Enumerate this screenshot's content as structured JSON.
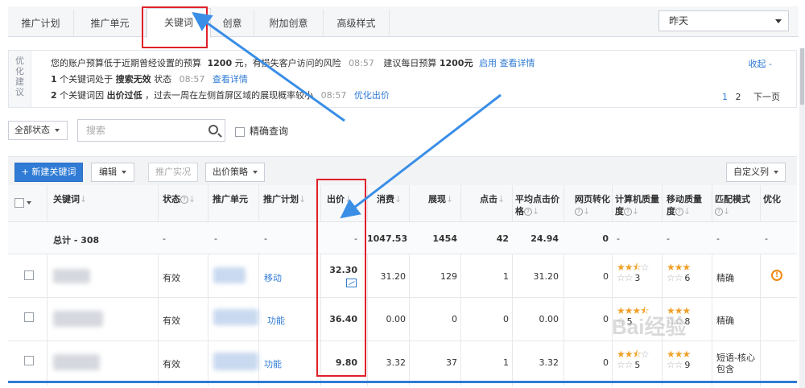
{
  "tabs": [
    {
      "label": "推广计划",
      "active": false
    },
    {
      "label": "推广单元",
      "active": false
    },
    {
      "label": "关键词",
      "active": true
    },
    {
      "label": "创意",
      "active": false
    },
    {
      "label": "附加创意",
      "active": false
    },
    {
      "label": "高级样式",
      "active": false
    }
  ],
  "date_select": {
    "value": "昨天"
  },
  "suggestions": {
    "side_label": "优化建议",
    "line1": {
      "pre": "您的账户预算低于近期曾经设置的预算",
      "budget": "1200",
      "mid": "元，有损失客户访问的风险",
      "time": "08:57",
      "suggest": "建议每日预算",
      "suggest_value": "1200元",
      "link1": "启用",
      "link2": "查看详情"
    },
    "line2": {
      "count": "1",
      "pre": "个关键词处于",
      "status": "搜索无效",
      "post": "状态",
      "time": "08:57",
      "link": "查看详情"
    },
    "line3": {
      "count": "2",
      "pre": "个关键词因",
      "reason": "出价过低",
      "post": "，过去一周在左侧首屏区域的展现概率较小",
      "time": "08:57",
      "link": "优化出价"
    },
    "collapse": "收起 -",
    "pager": {
      "p1": "1",
      "p2": "2",
      "next": "下一页"
    }
  },
  "filter": {
    "state": "全部状态",
    "search_placeholder": "搜索",
    "exact": "精确查询"
  },
  "toolbar": {
    "new_keyword": "+ 新建关键词",
    "edit": "编辑",
    "promo_test": "推广实况",
    "bid_strategy": "出价策略",
    "custom_cols": "自定义列"
  },
  "columns": {
    "keyword": "关键词",
    "status": "状态",
    "unit": "推广单元",
    "plan": "推广计划",
    "bid": "出价",
    "cost": "消费",
    "impressions": "展现",
    "clicks": "点击",
    "avg_cpc_1": "平均点击价",
    "avg_cpc_2": "格",
    "conv_1": "网页转化",
    "pc_quality_1": "计算机质量",
    "pc_quality_2": "度",
    "mobile_quality_1": "移动质量",
    "mobile_quality_2": "度",
    "match": "匹配模式",
    "optimize": "优化"
  },
  "total": {
    "label": "总计 - 308",
    "status": "-",
    "unit": "-",
    "plan": "-",
    "bid": "-",
    "cost": "1047.53",
    "impressions": "1454",
    "clicks": "42",
    "avg_cpc": "24.94",
    "conv": "0",
    "pc_quality": "-",
    "mobile_quality": "-",
    "match": "-",
    "optimize": "-"
  },
  "rows": [
    {
      "status": "有效",
      "plan": "移动",
      "bid": "32.30",
      "cost": "31.20",
      "impressions": "129",
      "clicks": "1",
      "avg_cpc": "31.20",
      "conv": "0",
      "pc_stars": 2.5,
      "pc_score": "3",
      "mobile_stars": 3,
      "mobile_score": "6",
      "match": "精确",
      "has_warning": true
    },
    {
      "status": "有效",
      "plan": "功能",
      "bid": "36.40",
      "cost": "0.00",
      "impressions": "0",
      "clicks": "0",
      "avg_cpc": "0.00",
      "conv": "0",
      "pc_stars": 3.5,
      "pc_score": "5",
      "mobile_stars": 3,
      "mobile_score": "8",
      "match": "精确",
      "has_warning": false
    },
    {
      "status": "有效",
      "plan": "功能",
      "bid": "9.80",
      "cost": "3.32",
      "impressions": "37",
      "clicks": "1",
      "avg_cpc": "3.32",
      "conv": "0",
      "pc_stars": 3.5,
      "pc_score": "5",
      "mobile_stars": 3,
      "mobile_score": "9",
      "match": "短语-核心包含",
      "has_warning": false
    }
  ],
  "colors": {
    "accent": "#2f7bd5",
    "highlight_box": "#e0202a",
    "annotation_arrow": "#3a8ee6",
    "star": "#f0a12a",
    "warning": "#f08a12"
  }
}
